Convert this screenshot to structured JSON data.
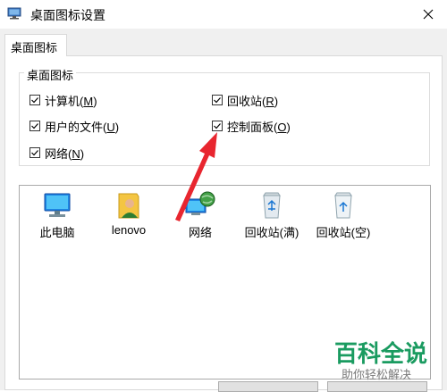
{
  "window": {
    "title": "桌面图标设置"
  },
  "tabs": [
    {
      "label": "桌面图标"
    }
  ],
  "group": {
    "legend": "桌面图标",
    "checkboxes": [
      {
        "text": "计算机(",
        "key": "M",
        "suffix": ")",
        "checked": true
      },
      {
        "text": "回收站(",
        "key": "R",
        "suffix": ")",
        "checked": true
      },
      {
        "text": "用户的文件(",
        "key": "U",
        "suffix": ")",
        "checked": true
      },
      {
        "text": "控制面板(",
        "key": "O",
        "suffix": ")",
        "checked": true
      },
      {
        "text": "网络(",
        "key": "N",
        "suffix": ")",
        "checked": true
      }
    ]
  },
  "icons": [
    {
      "label": "此电脑",
      "icon": "computer-icon"
    },
    {
      "label": "lenovo",
      "icon": "user-folder-icon"
    },
    {
      "label": "网络",
      "icon": "network-icon"
    },
    {
      "label": "回收站(满)",
      "icon": "recycle-bin-full-icon"
    },
    {
      "label": "回收站(空)",
      "icon": "recycle-bin-empty-icon"
    }
  ],
  "watermark": {
    "main": "百科全说",
    "sub": "助你轻松解决"
  },
  "colors": {
    "accent": "#0078d7",
    "annotation_arrow": "#e8262f",
    "watermark": "#1a9b60"
  }
}
